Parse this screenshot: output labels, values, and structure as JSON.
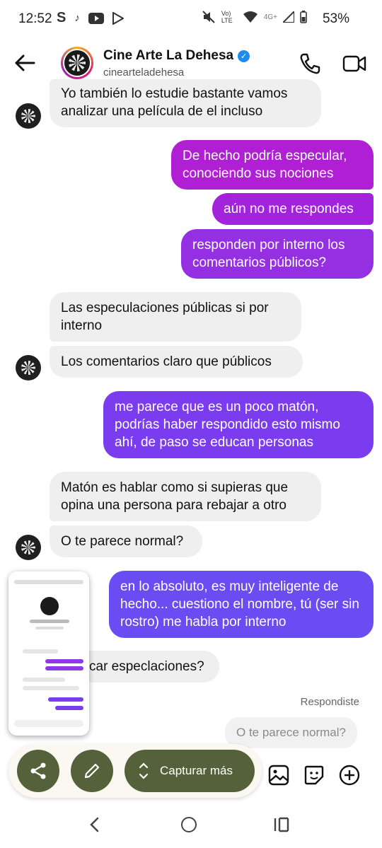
{
  "status_bar": {
    "time": "12:52",
    "battery": "53%",
    "network_label": "4G+",
    "volte_label": "Vo) LTE"
  },
  "header": {
    "name": "Cine Arte La Dehesa",
    "username": "cinearteladehesa",
    "verified": true
  },
  "messages": [
    {
      "side": "in",
      "text": "Yo también lo estudie bastante vamos analizar una película de el incluso"
    },
    {
      "side": "out",
      "text": "De hecho podría especular, conociendo sus nociones"
    },
    {
      "side": "out",
      "text": "aún no me respondes"
    },
    {
      "side": "out",
      "text": "responden por interno los comentarios públicos?"
    },
    {
      "side": "in",
      "text": "Las especulaciones públicas si por interno"
    },
    {
      "side": "in",
      "text": "Los comentarios claro que públicos"
    },
    {
      "side": "out",
      "text": "me parece que es un poco matón, podrías haber respondido esto mismo ahí, de paso se educan personas"
    },
    {
      "side": "in",
      "text": "Matón es hablar como si supieras que opina una persona para rebajar a otro"
    },
    {
      "side": "in",
      "text": "O te parece normal?"
    },
    {
      "side": "out",
      "text": "en lo absoluto, es muy inteligente de hecho... cuestiono el nombre, tú (ser sin rostro) me habla por interno"
    },
    {
      "side": "in",
      "text": "car especlaciones?"
    }
  ],
  "reply": {
    "label": "Respondiste",
    "preview": "O te parece normal?"
  },
  "screenshot_toolbar": {
    "capture_more": "Capturar más"
  },
  "colors": {
    "out_top": "#b11fd4",
    "out_mid": "#7b3cf0",
    "out_bottom": "#6a4cf3",
    "toolbar_button": "#55613a",
    "verified_blue": "#1d8cf0"
  }
}
